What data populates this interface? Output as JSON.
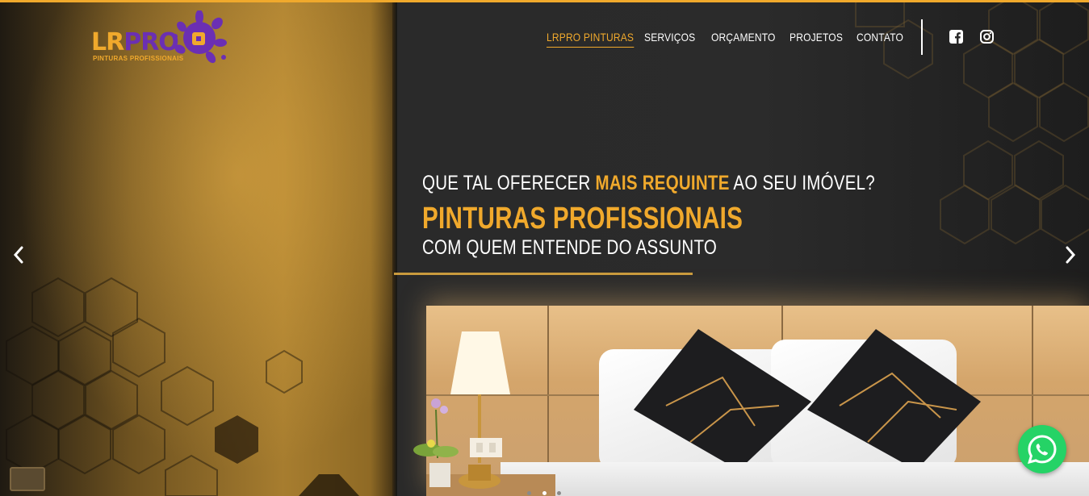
{
  "brand": {
    "name_part1": "LR",
    "name_part2": "PRO",
    "tagline": "PINTURAS PROFISSIONAIS",
    "accent_color": "#f0a92c",
    "secondary_color": "#6b2fb3"
  },
  "nav": {
    "items": [
      {
        "label": "LRPRO PINTURAS",
        "active": true
      },
      {
        "label": "SERVIÇOS",
        "active": false
      },
      {
        "label": "ORÇAMENTO",
        "active": false
      },
      {
        "label": "PROJETOS",
        "active": false
      },
      {
        "label": "CONTATO",
        "active": false
      }
    ],
    "social": [
      {
        "icon": "facebook-icon"
      },
      {
        "icon": "instagram-icon"
      }
    ]
  },
  "hero": {
    "line1_before": "QUE TAL OFERECER ",
    "line1_highlight": "MAIS REQUINTE",
    "line1_after": " AO SEU IMÓVEL?",
    "line2": "PINTURAS PROFISSIONAIS",
    "line3": "COM QUEM ENTENDE DO ASSUNTO"
  },
  "slider": {
    "prev_icon": "chevron-left-icon",
    "next_icon": "chevron-right-icon",
    "slide_count": 3,
    "active_slide": 2
  },
  "whatsapp": {
    "icon": "whatsapp-icon",
    "color": "#25d366"
  }
}
